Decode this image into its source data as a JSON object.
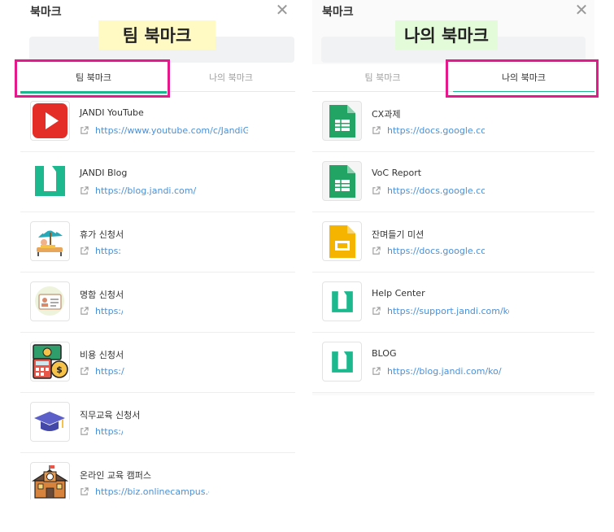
{
  "left_panel": {
    "title": "북마크",
    "close_label": "✕",
    "tabs": [
      {
        "label": "팀 북마크",
        "active": true
      },
      {
        "label": "나의 북마크",
        "active": false
      }
    ],
    "items": [
      {
        "icon": "youtube-icon",
        "name": "JANDI YouTube",
        "url": "https://www.youtube.com/c/JandiGlobal"
      },
      {
        "icon": "jandi-logo-icon",
        "name": "JANDI Blog",
        "url": "https://blog.jandi.com/"
      },
      {
        "icon": "beach-vacation-icon",
        "name": "휴가 신청서",
        "url": "https://"
      },
      {
        "icon": "business-card-icon",
        "name": "명함 신청서",
        "url": "https://"
      },
      {
        "icon": "money-calculator-icon",
        "name": "비용 신청서",
        "url": "https://("
      },
      {
        "icon": "graduation-cap-icon",
        "name": "직무교육 신청서",
        "url": "https://"
      },
      {
        "icon": "school-building-icon",
        "name": "온라인 교육 캠퍼스",
        "url": "https://biz.onlinecampus.co.k"
      }
    ]
  },
  "right_panel": {
    "title": "북마크",
    "close_label": "✕",
    "tabs": [
      {
        "label": "팀 북마크",
        "active": false
      },
      {
        "label": "나의 북마크",
        "active": true
      }
    ],
    "items": [
      {
        "icon": "google-sheets-icon",
        "name": "CX과제",
        "url": "https://docs.google.com/s"
      },
      {
        "icon": "google-sheets-icon",
        "name": "VoC Report",
        "url": "https://docs.google.com/"
      },
      {
        "icon": "google-slides-icon",
        "name": "잔며들기 미션",
        "url": "https://docs.google.com/"
      },
      {
        "icon": "jandi-logo-icon",
        "name": "Help Center",
        "url": "https://support.jandi.com/ko/"
      },
      {
        "icon": "jandi-logo-icon",
        "name": "BLOG",
        "url": "https://blog.jandi.com/ko/"
      }
    ]
  },
  "annotations": {
    "left_callout": "팀 북마크",
    "right_callout": "나의 북마크",
    "highlight_color": "#e6198c"
  },
  "colors": {
    "tab_indicator": "#1db88e",
    "link": "#4a90d9",
    "jandi_green": "#1db88e"
  }
}
